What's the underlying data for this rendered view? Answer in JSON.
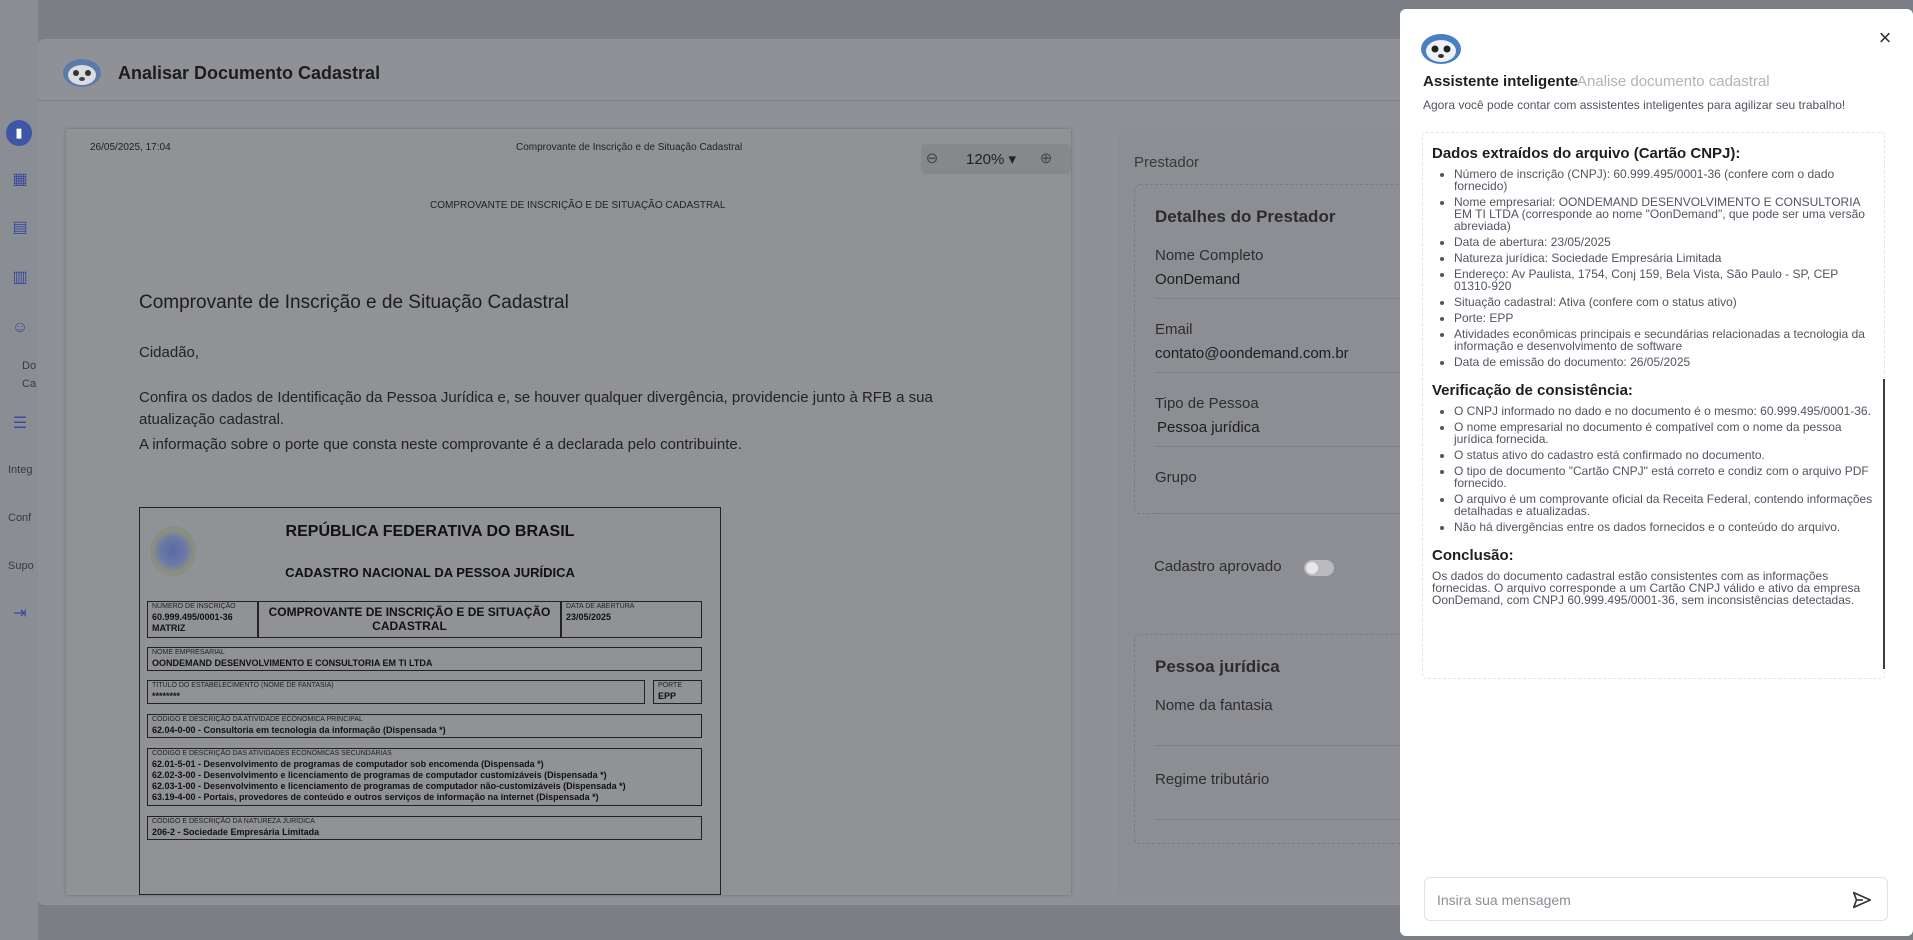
{
  "background_sidebar": {
    "labels": [
      "Do",
      "Ca",
      "Integ",
      "Conf",
      "Supo"
    ]
  },
  "modal": {
    "title": "Analisar Documento Cadastral"
  },
  "pdf": {
    "header_datetime": "26/05/2025, 17:04",
    "header_title": "Comprovante de Inscrição e de Situação Cadastral",
    "zoom": "120%",
    "page_caption": "COMPROVANTE DE INSCRIÇÃO E DE SITUAÇÃO CADASTRAL",
    "heading": "Comprovante de Inscrição e de Situação Cadastral",
    "greeting": "Cidadão,",
    "para1": "Confira os dados de Identificação da Pessoa Jurídica e, se houver qualquer divergência, providencie junto à RFB a sua atualização cadastral.",
    "para2": "A informação sobre o porte que consta neste comprovante é a declarada pelo contribuinte.",
    "certificate": {
      "title1": "REPÚBLICA FEDERATIVA DO BRASIL",
      "title2": "CADASTRO NACIONAL DA PESSOA JURÍDICA",
      "numero_label": "NÚMERO DE INSCRIÇÃO",
      "numero_value": "60.999.495/0001-36",
      "numero_type": "MATRIZ",
      "comprovante_title": "COMPROVANTE DE INSCRIÇÃO E DE SITUAÇÃO CADASTRAL",
      "abertura_label": "DATA DE ABERTURA",
      "abertura_value": "23/05/2025",
      "nome_label": "NOME EMPRESARIAL",
      "nome_value": "OONDEMAND DESENVOLVIMENTO E CONSULTORIA EM TI LTDA",
      "fantasia_label": "TÍTULO DO ESTABELECIMENTO (NOME DE FANTASIA)",
      "fantasia_value": "********",
      "porte_label": "PORTE",
      "porte_value": "EPP",
      "principal_label": "CÓDIGO E DESCRIÇÃO DA ATIVIDADE ECONÔMICA PRINCIPAL",
      "principal_value": "62.04-0-00 - Consultoria em tecnologia da informação (Dispensada *)",
      "secundarias_label": "CÓDIGO E DESCRIÇÃO DAS ATIVIDADES ECONÔMICAS SECUNDÁRIAS",
      "secundarias": [
        "62.01-5-01 - Desenvolvimento de programas de computador sob encomenda (Dispensada *)",
        "62.02-3-00 - Desenvolvimento e licenciamento de programas de computador customizáveis (Dispensada *)",
        "62.03-1-00 - Desenvolvimento e licenciamento de programas de computador não-customizáveis (Dispensada *)",
        "63.19-4-00 - Portais, provedores de conteúdo e outros serviços de informação na internet (Dispensada *)"
      ],
      "natureza_label": "CÓDIGO E DESCRIÇÃO DA NATUREZA JURÍDICA",
      "natureza_value": "206-2 - Sociedade Empresária Limitada"
    }
  },
  "form": {
    "section_label": "Prestador",
    "details_title": "Detalhes do Prestador",
    "nome_label": "Nome Completo",
    "nome_value": "OonDemand",
    "email_label": "Email",
    "email_value": "contato@oondemand.com.br",
    "tipo_label": "Tipo de Pessoa",
    "tipo_value": "Pessoa jurídica",
    "grupo_label": "Grupo",
    "aprovado_label": "Cadastro aprovado",
    "pj_title": "Pessoa jurídica",
    "fantasia_label": "Nome da fantasia",
    "regime_label": "Regime tributário"
  },
  "assistant": {
    "title": "Assistente inteligente",
    "subtitle": "Analise documento cadastral",
    "description": "Agora você pode contar com assistentes inteligentes para agilizar seu trabalho!",
    "section1_title": "Dados extraídos do arquivo (Cartão CNPJ):",
    "section1_items": [
      "Número de inscrição (CNPJ): 60.999.495/0001-36 (confere com o dado fornecido)",
      "Nome empresarial: OONDEMAND DESENVOLVIMENTO E CONSULTORIA EM TI LTDA (corresponde ao nome \"OonDemand\", que pode ser uma versão abreviada)",
      "Data de abertura: 23/05/2025",
      "Natureza jurídica: Sociedade Empresária Limitada",
      "Endereço: Av Paulista, 1754, Conj 159, Bela Vista, São Paulo - SP, CEP 01310-920",
      "Situação cadastral: Ativa (confere com o status ativo)",
      "Porte: EPP",
      "Atividades econômicas principais e secundárias relacionadas a tecnologia da informação e desenvolvimento de software",
      "Data de emissão do documento: 26/05/2025"
    ],
    "section2_title": "Verificação de consistência:",
    "section2_items": [
      "O CNPJ informado no dado e no documento é o mesmo: 60.999.495/0001-36.",
      "O nome empresarial no documento é compatível com o nome da pessoa jurídica fornecida.",
      "O status ativo do cadastro está confirmado no documento.",
      "O tipo de documento \"Cartão CNPJ\" está correto e condiz com o arquivo PDF fornecido.",
      "O arquivo é um comprovante oficial da Receita Federal, contendo informações detalhadas e atualizadas.",
      "Não há divergências entre os dados fornecidos e o conteúdo do arquivo."
    ],
    "section3_title": "Conclusão:",
    "conclusion": "Os dados do documento cadastral estão consistentes com as informações fornecidas. O arquivo corresponde a um Cartão CNPJ válido e ativo da empresa OonDemand, com CNPJ 60.999.495/0001-36, sem inconsistências detectadas.",
    "input_placeholder": "Insira sua mensagem"
  }
}
